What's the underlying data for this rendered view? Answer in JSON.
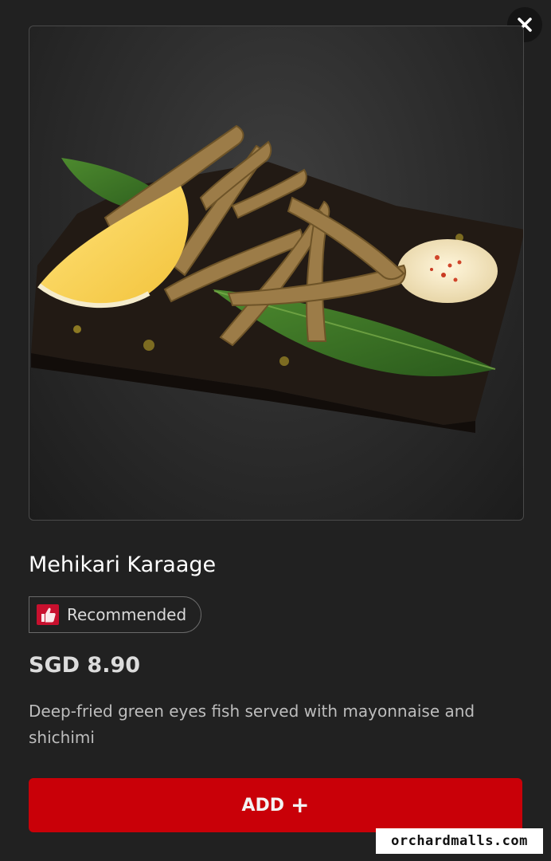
{
  "dialog": {
    "close_icon": "close-icon",
    "image_alt": "Mehikari Karaage",
    "title": "Mehikari Karaage",
    "badge": {
      "icon": "thumbs-up-icon",
      "label": "Recommended",
      "icon_color": "#c8102e"
    },
    "price": "SGD 8.90",
    "description": "Deep-fried green eyes fish served with mayonnaise and shichimi",
    "add_button": {
      "label": "ADD",
      "icon": "plus-icon",
      "color": "#c90008"
    }
  },
  "watermark": "orchardmalls.com"
}
